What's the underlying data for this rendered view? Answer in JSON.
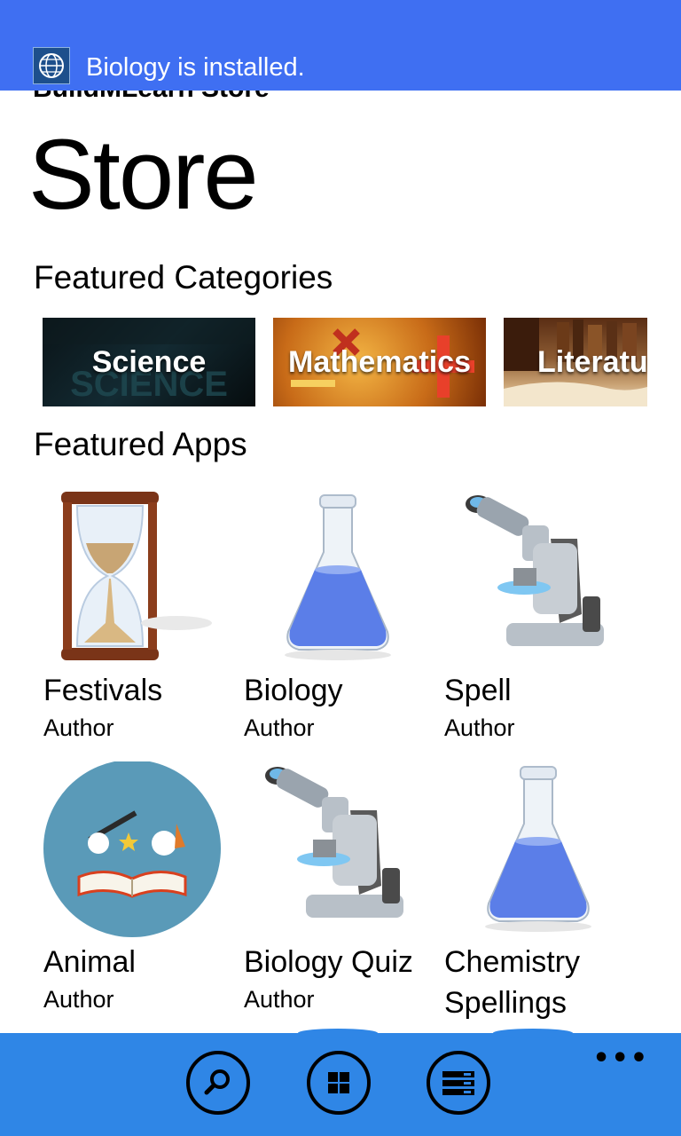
{
  "toast": {
    "text": "Biology is installed.",
    "icon": "globe-icon"
  },
  "app_title": "BuildMLearn Store",
  "page_title": "Store",
  "featured_categories": {
    "title": "Featured Categories",
    "items": [
      {
        "label": "Science"
      },
      {
        "label": "Mathematics"
      },
      {
        "label": "Literatu"
      }
    ]
  },
  "featured_apps": {
    "title": "Featured Apps",
    "items": [
      {
        "name": "Festivals",
        "author": "Author",
        "icon": "hourglass-icon"
      },
      {
        "name": "Biology",
        "author": "Author",
        "icon": "flask-icon"
      },
      {
        "name": "Spell",
        "author": "Author",
        "icon": "microscope-icon"
      },
      {
        "name": "Animal",
        "author": "Author",
        "icon": "magic-book-icon"
      },
      {
        "name": "Biology Quiz",
        "author": "Author",
        "icon": "microscope-icon"
      },
      {
        "name": "Chemistry",
        "author": "Spellings",
        "icon": "flask-icon"
      }
    ]
  },
  "app_bar": {
    "buttons": [
      {
        "icon": "search-icon"
      },
      {
        "icon": "grid-icon"
      },
      {
        "icon": "list-icon"
      }
    ],
    "more": "•••"
  },
  "colors": {
    "toast": "#3f6ff2",
    "app_bar": "#2f86e6"
  }
}
